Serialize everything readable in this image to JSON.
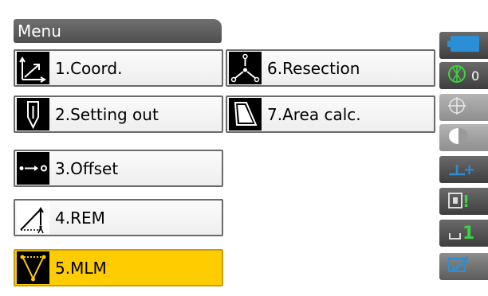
{
  "menu": {
    "title": "Menu",
    "items": [
      {
        "label": "1.Coord.",
        "icon": "coordinate-axes-icon",
        "selected": false
      },
      {
        "label": "2.Setting out",
        "icon": "stake-icon",
        "selected": false
      },
      {
        "label": "3.Offset",
        "icon": "offset-arrow-icon",
        "selected": false
      },
      {
        "label": "4.REM",
        "icon": "remote-elevation-icon",
        "selected": false
      },
      {
        "label": "5.MLM",
        "icon": "missing-line-icon",
        "selected": true
      },
      {
        "label": "6.Resection",
        "icon": "resection-icon",
        "selected": false
      },
      {
        "label": "7.Area calc.",
        "icon": "area-polygon-icon",
        "selected": false
      }
    ]
  },
  "side_panel": {
    "items": [
      {
        "icon": "battery-icon"
      },
      {
        "icon": "prism-target-icon",
        "text": "0"
      },
      {
        "icon": "crosshair-icon"
      },
      {
        "icon": "half-circle-icon"
      },
      {
        "icon": "add-height-icon",
        "text": "+"
      },
      {
        "icon": "display-flag-icon",
        "text": "!"
      },
      {
        "icon": "step-one-icon",
        "text": "1"
      },
      {
        "icon": "pen-edit-icon"
      }
    ]
  },
  "colors": {
    "selected": "#ffcc00",
    "title_bar": "#5a5a5a",
    "button_border": "#6a6a6a",
    "accent_blue": "#2a8fd6",
    "accent_green": "#3ed33e",
    "icon_bg": "#000000"
  }
}
